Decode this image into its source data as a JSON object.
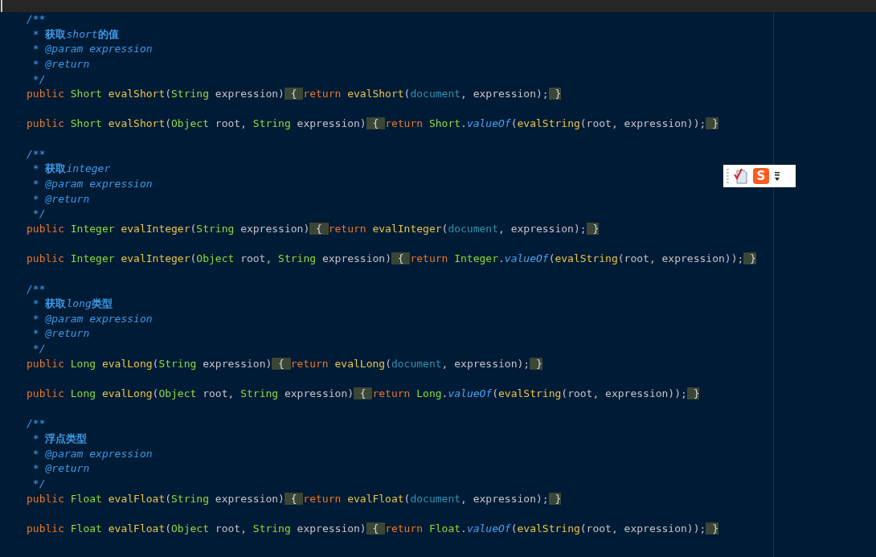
{
  "editor": {
    "lines": [
      {
        "kind": "code",
        "tokens": [
          {
            "text": "/**",
            "kind": "c"
          }
        ]
      },
      {
        "kind": "code",
        "tokens": [
          {
            "text": " * ",
            "kind": "c"
          },
          {
            "text": "获取",
            "kind": "cb"
          },
          {
            "text": "short",
            "kind": "c"
          },
          {
            "text": "的值",
            "kind": "cb"
          }
        ]
      },
      {
        "kind": "code",
        "tokens": [
          {
            "text": " * @param expression",
            "kind": "c"
          }
        ]
      },
      {
        "kind": "code",
        "tokens": [
          {
            "text": " * @return",
            "kind": "c"
          }
        ]
      },
      {
        "kind": "code",
        "tokens": [
          {
            "text": " */",
            "kind": "c"
          }
        ]
      },
      {
        "kind": "code",
        "tokens": [
          {
            "text": "public ",
            "kind": "k"
          },
          {
            "text": "Short ",
            "kind": "t"
          },
          {
            "text": "evalShort",
            "kind": "m"
          },
          {
            "text": "(",
            "kind": "p"
          },
          {
            "text": "String",
            "kind": "t"
          },
          {
            "text": " expression)",
            "kind": "p"
          },
          {
            "text": "{",
            "kind": "b"
          },
          {
            "text": "return ",
            "kind": "k"
          },
          {
            "text": "evalShort",
            "kind": "m"
          },
          {
            "text": "(",
            "kind": "p"
          },
          {
            "text": "document",
            "kind": "d"
          },
          {
            "text": ", expression);",
            "kind": "p"
          },
          {
            "text": "}",
            "kind": "b"
          }
        ]
      },
      {
        "kind": "blank"
      },
      {
        "kind": "code",
        "tokens": [
          {
            "text": "public ",
            "kind": "k"
          },
          {
            "text": "Short ",
            "kind": "t"
          },
          {
            "text": "evalShort",
            "kind": "m"
          },
          {
            "text": "(",
            "kind": "p"
          },
          {
            "text": "Object",
            "kind": "t"
          },
          {
            "text": " root, ",
            "kind": "p"
          },
          {
            "text": "String",
            "kind": "t"
          },
          {
            "text": " expression)",
            "kind": "p"
          },
          {
            "text": "{",
            "kind": "b"
          },
          {
            "text": "return ",
            "kind": "k"
          },
          {
            "text": "Short",
            "kind": "t"
          },
          {
            "text": ".",
            "kind": "p"
          },
          {
            "text": "valueOf",
            "kind": "i"
          },
          {
            "text": "(",
            "kind": "p"
          },
          {
            "text": "evalString",
            "kind": "m"
          },
          {
            "text": "(root, expression));",
            "kind": "p"
          },
          {
            "text": "}",
            "kind": "b"
          }
        ]
      },
      {
        "kind": "blank"
      },
      {
        "kind": "code",
        "tokens": [
          {
            "text": "/**",
            "kind": "c"
          }
        ]
      },
      {
        "kind": "code",
        "tokens": [
          {
            "text": " * ",
            "kind": "c"
          },
          {
            "text": "获取",
            "kind": "cb"
          },
          {
            "text": "integer",
            "kind": "c"
          }
        ]
      },
      {
        "kind": "code",
        "tokens": [
          {
            "text": " * @param expression",
            "kind": "c"
          }
        ]
      },
      {
        "kind": "code",
        "tokens": [
          {
            "text": " * @return",
            "kind": "c"
          }
        ]
      },
      {
        "kind": "code",
        "tokens": [
          {
            "text": " */",
            "kind": "c"
          }
        ]
      },
      {
        "kind": "code",
        "tokens": [
          {
            "text": "public ",
            "kind": "k"
          },
          {
            "text": "Integer ",
            "kind": "t"
          },
          {
            "text": "evalInteger",
            "kind": "m"
          },
          {
            "text": "(",
            "kind": "p"
          },
          {
            "text": "String",
            "kind": "t"
          },
          {
            "text": " expression)",
            "kind": "p"
          },
          {
            "text": "{",
            "kind": "b"
          },
          {
            "text": "return ",
            "kind": "k"
          },
          {
            "text": "evalInteger",
            "kind": "m"
          },
          {
            "text": "(",
            "kind": "p"
          },
          {
            "text": "document",
            "kind": "d"
          },
          {
            "text": ", expression);",
            "kind": "p"
          },
          {
            "text": "}",
            "kind": "b"
          }
        ]
      },
      {
        "kind": "blank"
      },
      {
        "kind": "code",
        "tokens": [
          {
            "text": "public ",
            "kind": "k"
          },
          {
            "text": "Integer ",
            "kind": "t"
          },
          {
            "text": "evalInteger",
            "kind": "m"
          },
          {
            "text": "(",
            "kind": "p"
          },
          {
            "text": "Object",
            "kind": "t"
          },
          {
            "text": " root, ",
            "kind": "p"
          },
          {
            "text": "String",
            "kind": "t"
          },
          {
            "text": " expression)",
            "kind": "p"
          },
          {
            "text": "{",
            "kind": "b"
          },
          {
            "text": "return ",
            "kind": "k"
          },
          {
            "text": "Integer",
            "kind": "t"
          },
          {
            "text": ".",
            "kind": "p"
          },
          {
            "text": "valueOf",
            "kind": "i"
          },
          {
            "text": "(",
            "kind": "p"
          },
          {
            "text": "evalString",
            "kind": "m"
          },
          {
            "text": "(root, expression));",
            "kind": "p"
          },
          {
            "text": "}",
            "kind": "b"
          }
        ]
      },
      {
        "kind": "blank"
      },
      {
        "kind": "code",
        "tokens": [
          {
            "text": "/**",
            "kind": "c"
          }
        ]
      },
      {
        "kind": "code",
        "tokens": [
          {
            "text": " * ",
            "kind": "c"
          },
          {
            "text": "获取",
            "kind": "cb"
          },
          {
            "text": "long",
            "kind": "c"
          },
          {
            "text": "类型",
            "kind": "cb"
          }
        ]
      },
      {
        "kind": "code",
        "tokens": [
          {
            "text": " * @param expression",
            "kind": "c"
          }
        ]
      },
      {
        "kind": "code",
        "tokens": [
          {
            "text": " * @return",
            "kind": "c"
          }
        ]
      },
      {
        "kind": "code",
        "tokens": [
          {
            "text": " */",
            "kind": "c"
          }
        ]
      },
      {
        "kind": "code",
        "tokens": [
          {
            "text": "public ",
            "kind": "k"
          },
          {
            "text": "Long ",
            "kind": "t"
          },
          {
            "text": "evalLong",
            "kind": "m"
          },
          {
            "text": "(",
            "kind": "p"
          },
          {
            "text": "String",
            "kind": "t"
          },
          {
            "text": " expression)",
            "kind": "p"
          },
          {
            "text": "{",
            "kind": "b"
          },
          {
            "text": "return ",
            "kind": "k"
          },
          {
            "text": "evalLong",
            "kind": "m"
          },
          {
            "text": "(",
            "kind": "p"
          },
          {
            "text": "document",
            "kind": "d"
          },
          {
            "text": ", expression);",
            "kind": "p"
          },
          {
            "text": "}",
            "kind": "b"
          }
        ]
      },
      {
        "kind": "blank"
      },
      {
        "kind": "code",
        "tokens": [
          {
            "text": "public ",
            "kind": "k"
          },
          {
            "text": "Long ",
            "kind": "t"
          },
          {
            "text": "evalLong",
            "kind": "m"
          },
          {
            "text": "(",
            "kind": "p"
          },
          {
            "text": "Object",
            "kind": "t"
          },
          {
            "text": " root, ",
            "kind": "p"
          },
          {
            "text": "String",
            "kind": "t"
          },
          {
            "text": " expression)",
            "kind": "p"
          },
          {
            "text": "{",
            "kind": "b"
          },
          {
            "text": "return ",
            "kind": "k"
          },
          {
            "text": "Long",
            "kind": "t"
          },
          {
            "text": ".",
            "kind": "p"
          },
          {
            "text": "valueOf",
            "kind": "i"
          },
          {
            "text": "(",
            "kind": "p"
          },
          {
            "text": "evalString",
            "kind": "m"
          },
          {
            "text": "(root, expression));",
            "kind": "p"
          },
          {
            "text": "}",
            "kind": "b"
          }
        ]
      },
      {
        "kind": "blank"
      },
      {
        "kind": "code",
        "tokens": [
          {
            "text": "/**",
            "kind": "c"
          }
        ]
      },
      {
        "kind": "code",
        "tokens": [
          {
            "text": " * ",
            "kind": "c"
          },
          {
            "text": "浮点类型",
            "kind": "cb"
          }
        ]
      },
      {
        "kind": "code",
        "tokens": [
          {
            "text": " * @param expression",
            "kind": "c"
          }
        ]
      },
      {
        "kind": "code",
        "tokens": [
          {
            "text": " * @return",
            "kind": "c"
          }
        ]
      },
      {
        "kind": "code",
        "tokens": [
          {
            "text": " */",
            "kind": "c"
          }
        ]
      },
      {
        "kind": "code",
        "tokens": [
          {
            "text": "public ",
            "kind": "k"
          },
          {
            "text": "Float ",
            "kind": "t"
          },
          {
            "text": "evalFloat",
            "kind": "m"
          },
          {
            "text": "(",
            "kind": "p"
          },
          {
            "text": "String",
            "kind": "t"
          },
          {
            "text": " expression)",
            "kind": "p"
          },
          {
            "text": "{",
            "kind": "b"
          },
          {
            "text": "return ",
            "kind": "k"
          },
          {
            "text": "evalFloat",
            "kind": "m"
          },
          {
            "text": "(",
            "kind": "p"
          },
          {
            "text": "document",
            "kind": "d"
          },
          {
            "text": ", expression);",
            "kind": "p"
          },
          {
            "text": "}",
            "kind": "b"
          }
        ]
      },
      {
        "kind": "blank"
      },
      {
        "kind": "code",
        "tokens": [
          {
            "text": "public ",
            "kind": "k"
          },
          {
            "text": "Float ",
            "kind": "t"
          },
          {
            "text": "evalFloat",
            "kind": "m"
          },
          {
            "text": "(",
            "kind": "p"
          },
          {
            "text": "Object",
            "kind": "t"
          },
          {
            "text": " root, ",
            "kind": "p"
          },
          {
            "text": "String",
            "kind": "t"
          },
          {
            "text": " expression)",
            "kind": "p"
          },
          {
            "text": "{",
            "kind": "b"
          },
          {
            "text": "return ",
            "kind": "k"
          },
          {
            "text": "Float",
            "kind": "t"
          },
          {
            "text": ".",
            "kind": "p"
          },
          {
            "text": "valueOf",
            "kind": "i"
          },
          {
            "text": "(",
            "kind": "p"
          },
          {
            "text": "evalString",
            "kind": "m"
          },
          {
            "text": "(root, expression));",
            "kind": "p"
          },
          {
            "text": "}",
            "kind": "b"
          }
        ]
      }
    ]
  },
  "ime_toolbar": {
    "logo_text": "S"
  }
}
